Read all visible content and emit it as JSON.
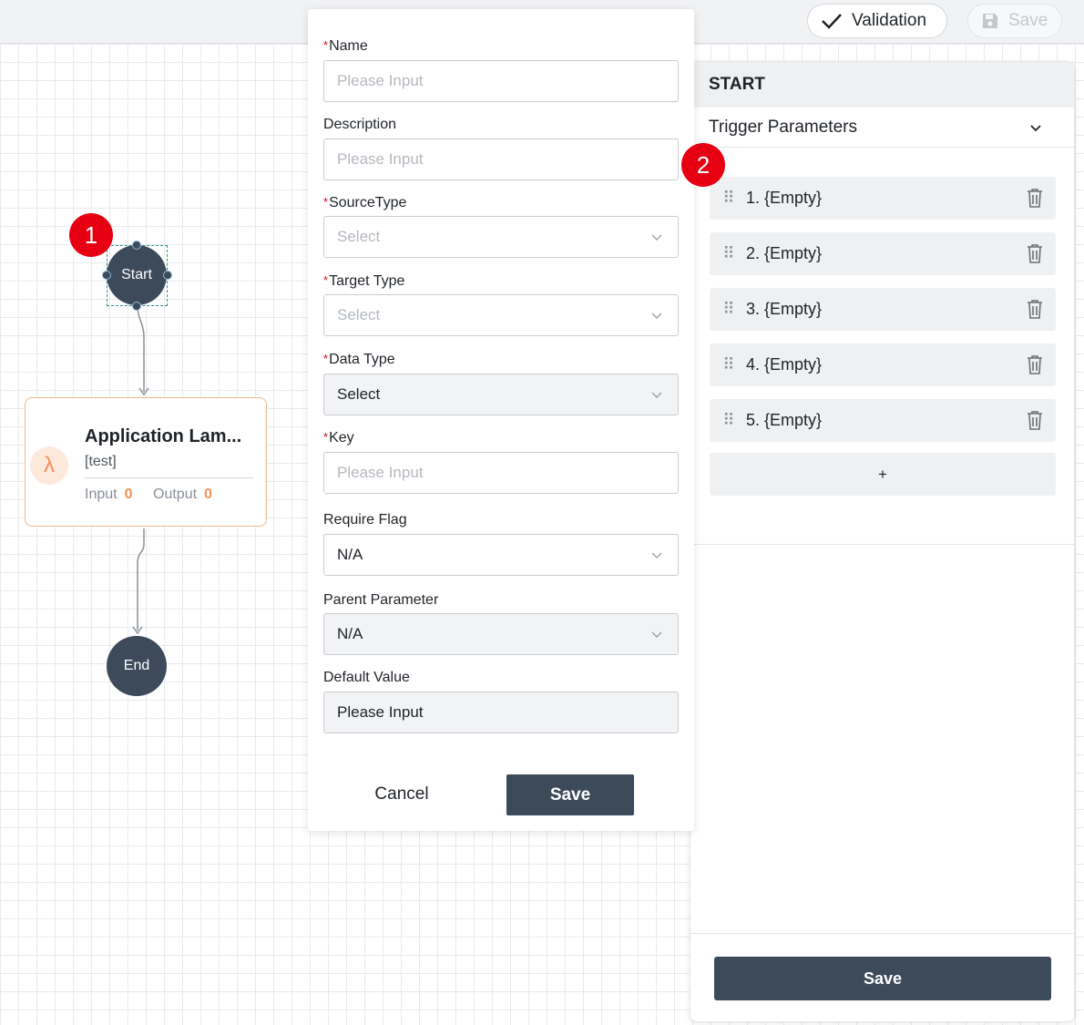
{
  "toolbar": {
    "validation_label": "Validation",
    "save_label": "Save"
  },
  "flow": {
    "start_label": "Start",
    "end_label": "End",
    "lambda": {
      "title": "Application Lam...",
      "subtitle": "[test]",
      "input_label": "Input",
      "input_count": "0",
      "output_label": "Output",
      "output_count": "0",
      "icon": "lambda-icon",
      "accent": "#f0925a"
    }
  },
  "badges": [
    "1",
    "2"
  ],
  "form": {
    "name": {
      "label": "Name",
      "required": "*",
      "placeholder": "Please Input"
    },
    "description": {
      "label": "Description",
      "placeholder": "Please Input"
    },
    "source_type": {
      "label": "SourceType",
      "required": "*",
      "placeholder": "Select"
    },
    "target_type": {
      "label": "Target Type",
      "required": "*",
      "placeholder": "Select"
    },
    "data_type": {
      "label": "Data Type",
      "required": "*",
      "placeholder": "Select"
    },
    "key": {
      "label": "Key",
      "required": "*",
      "placeholder": "Please Input"
    },
    "require_flag": {
      "label": "Require Flag",
      "value": "N/A"
    },
    "parent_parameter": {
      "label": "Parent Parameter",
      "value": "N/A"
    },
    "default_value": {
      "label": "Default Value",
      "value": "Please Input"
    },
    "cancel_label": "Cancel",
    "save_label": "Save"
  },
  "panel": {
    "title": "START",
    "section_label": "Trigger Parameters",
    "params": [
      "1. {Empty}",
      "2. {Empty}",
      "3. {Empty}",
      "4. {Empty}",
      "5. {Empty}"
    ],
    "add_label": "+",
    "save_label": "Save"
  },
  "colors": {
    "primary_dark": "#3d4a5a",
    "required_red": "#e60012",
    "badge_red": "#e60012"
  }
}
